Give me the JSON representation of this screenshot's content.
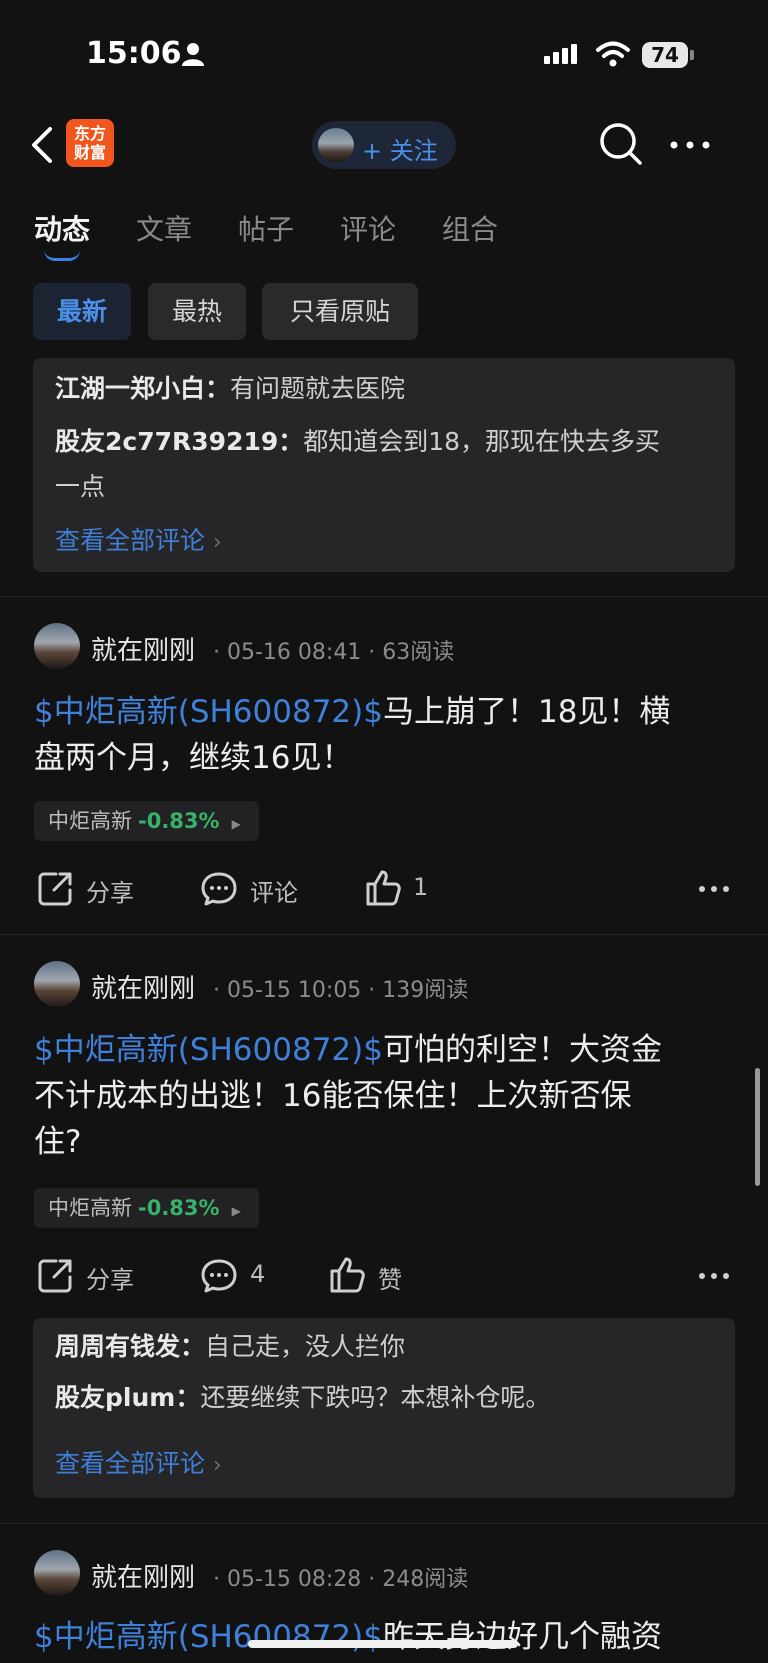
{
  "status": {
    "time": "15:06",
    "battery": "74"
  },
  "header": {
    "logo_line1": "东方",
    "logo_line2": "财富",
    "follow_label": "+ 关注"
  },
  "tabs": [
    "动态",
    "文章",
    "帖子",
    "评论",
    "组合"
  ],
  "filters": [
    "最新",
    "最热",
    "只看原贴"
  ],
  "top_comments": {
    "c1": {
      "name": "江湖一郑小白：",
      "text": "有问题就去医院"
    },
    "c2": {
      "name": "股友2c77R39219：",
      "text": "都知道会到18，那现在快去多买",
      "text2": "一点"
    },
    "view_all": "查看全部评论"
  },
  "posts": [
    {
      "author": "就在刚刚",
      "meta": "· 05-16 08:41 · 63阅读",
      "tag": "$中炬高新(SH600872)$",
      "line1": "马上崩了！18见！横",
      "line2": "盘两个月，继续16见！",
      "stock": "中炬高新",
      "change": "-0.83%",
      "share": "分享",
      "comment": "评论",
      "likes": "1"
    },
    {
      "author": "就在刚刚",
      "meta": "· 05-15 10:05 · 139阅读",
      "tag": "$中炬高新(SH600872)$",
      "line1": "可怕的利空！大资金",
      "line2": "不计成本的出逃！16能否保住！上次新否保",
      "line3": "住?",
      "stock": "中炬高新",
      "change": "-0.83%",
      "share": "分享",
      "comment": "4",
      "likes": "赞",
      "comments": {
        "c1": {
          "name": "周周有钱发：",
          "text": "自己走，没人拦你"
        },
        "c2": {
          "name": "股友plum：",
          "text": "还要继续下跌吗？本想补仓呢。"
        },
        "view_all": "查看全部评论"
      }
    },
    {
      "author": "就在刚刚",
      "meta": "· 05-15 08:28 · 248阅读",
      "tag": "$中炬高新(SH600872)$",
      "line1": "昨天身边好几个融资"
    }
  ],
  "colors": {
    "accent": "#3f80d8",
    "up_down_green": "#38b26a",
    "logo": "#f0561d"
  }
}
